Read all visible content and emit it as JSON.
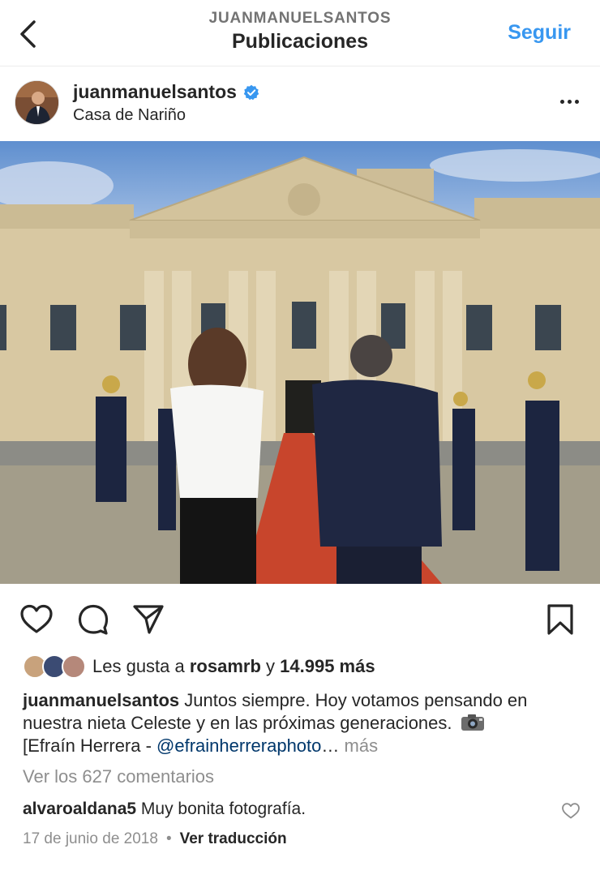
{
  "header": {
    "username_caps": "JUANMANUELSANTOS",
    "title": "Publicaciones",
    "follow_label": "Seguir"
  },
  "post": {
    "username": "juanmanuelsantos",
    "location": "Casa de Nariño",
    "verified": true
  },
  "likes": {
    "prefix": "Les gusta a ",
    "first_user": "rosamrb",
    "connector": " y ",
    "count": "14.995 más"
  },
  "caption": {
    "user": "juanmanuelsantos",
    "text": " Juntos siempre. Hoy votamos pensando en nuestra nieta Celeste y en las próximas generaciones. ",
    "credit_prefix": "[Efraín Herrera - ",
    "mention": "@efrainherreraphoto",
    "ellipsis": "… ",
    "more": "más"
  },
  "comments": {
    "view_all": "Ver los 627 comentarios",
    "first": {
      "user": "alvaroaldana5",
      "text": " Muy bonita fotografía."
    }
  },
  "meta": {
    "date": "17 de junio de 2018",
    "separator": "•",
    "translate": "Ver traducción"
  },
  "colors": {
    "accent": "#3897f0",
    "verified": "#3897f0",
    "secondary_text": "#8e8e8e",
    "mention": "#00376b"
  },
  "icons": [
    "back-arrow-icon",
    "verified-badge-icon",
    "more-options-icon",
    "heart-icon",
    "comment-icon",
    "share-icon",
    "bookmark-icon",
    "camera-emoji-icon",
    "comment-heart-icon"
  ]
}
